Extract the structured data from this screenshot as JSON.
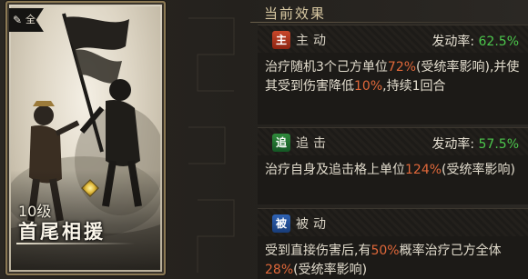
{
  "card": {
    "faction": "全",
    "level": "10级",
    "skill_name": "首尾相援"
  },
  "panel": {
    "header": "当前效果",
    "effects": [
      {
        "type": "主动",
        "badge": "主",
        "badge_color": "#b23a22",
        "rate_label": "发动率:",
        "rate_value": "62.5%",
        "desc": [
          "治疗随机3个己方单位",
          "72%",
          "(受统率影响),并使其受到伤害降低",
          "10%",
          ",持续1回合"
        ]
      },
      {
        "type": "追击",
        "badge": "追",
        "badge_color": "#1f7a32",
        "rate_label": "发动率:",
        "rate_value": "57.5%",
        "desc": [
          "治疗自身及追击格上单位",
          "124%",
          "(受统率影响)"
        ]
      },
      {
        "type": "被动",
        "badge": "被",
        "badge_color": "#24519a",
        "desc": [
          "受到直接伤害后,有",
          "50%",
          "概率治疗己方全体",
          "28%",
          "(受统率影响)"
        ]
      }
    ]
  },
  "colors": {
    "highlight": "#e0683a",
    "rate_value": "#4cc64c",
    "header_text": "#d9c9a3"
  }
}
